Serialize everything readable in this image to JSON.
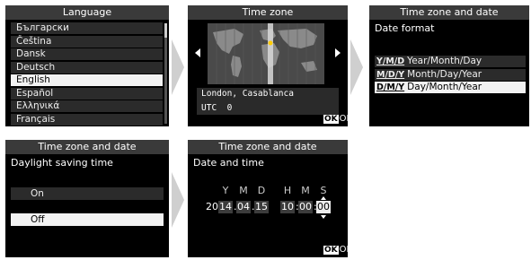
{
  "panels": {
    "language": {
      "title": "Language",
      "items": [
        "Български",
        "Čeština",
        "Dansk",
        "Deutsch",
        "English",
        "Español",
        "Ελληνικά",
        "Français"
      ],
      "selected_index": 4
    },
    "timezone": {
      "title": "Time zone",
      "location": "London, Casablanca",
      "utc": "UTC  0",
      "ok_icon": "OK",
      "ok_label": "OK"
    },
    "date_format": {
      "title": "Time zone and date",
      "subtitle": "Date format",
      "options": [
        {
          "glyph": "Y/M/D",
          "label": "Year/Month/Day"
        },
        {
          "glyph": "M/D/Y",
          "label": "Month/Day/Year"
        },
        {
          "glyph": "D/M/Y",
          "label": "Day/Month/Year"
        }
      ],
      "selected_index": 2
    },
    "dst": {
      "title": "Time zone and date",
      "subtitle": "Daylight saving time",
      "options": [
        "On",
        "Off"
      ],
      "selected_index": 1
    },
    "datetime": {
      "title": "Time zone and date",
      "subtitle": "Date and time",
      "labels": {
        "y": "Y",
        "m": "M",
        "d": "D",
        "h": "H",
        "min": "M",
        "s": "S"
      },
      "century": "20",
      "year": "14",
      "month": "04",
      "day": "15",
      "hour": "10",
      "minute": "00",
      "second": "00",
      "ok_icon": "OK",
      "ok_label": "OK"
    }
  },
  "colors": {
    "screen_bg": "#000000",
    "title_bar": "#3a3a3a",
    "selected_row": "#f2f2f2",
    "arrow": "#cfcfcf"
  }
}
